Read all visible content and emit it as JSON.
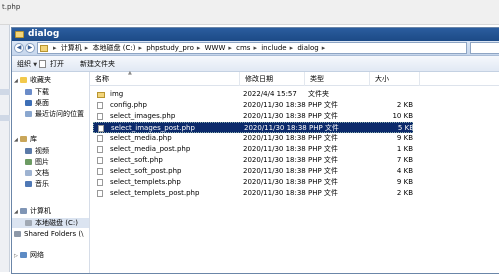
{
  "background": {
    "partial_title": "t.php"
  },
  "window": {
    "title": "dialog"
  },
  "address": {
    "crumbs": [
      "计算机",
      "本地磁盘 (C:)",
      "phpstudy_pro",
      "WWW",
      "cms",
      "include",
      "dialog"
    ]
  },
  "toolbar": {
    "organize": "组织",
    "open": "打开",
    "new_folder": "新建文件夹"
  },
  "nav": {
    "favorites": "收藏夹",
    "downloads": "下载",
    "desktop": "桌面",
    "recent": "最近访问的位置",
    "libraries": "库",
    "videos": "视频",
    "pictures": "图片",
    "documents": "文档",
    "music": "音乐",
    "computer": "计算机",
    "local_disk": "本地磁盘 (C:)",
    "shared": "Shared Folders (\\",
    "network": "网络"
  },
  "columns": {
    "name": "名称",
    "modified": "修改日期",
    "type": "类型",
    "size": "大小"
  },
  "files": [
    {
      "name": "img",
      "modified": "2022/4/4 15:57",
      "type": "文件夹",
      "size": "",
      "kind": "folder"
    },
    {
      "name": "config.php",
      "modified": "2020/11/30 18:38",
      "type": "PHP 文件",
      "size": "2 KB",
      "kind": "file"
    },
    {
      "name": "select_images.php",
      "modified": "2020/11/30 18:38",
      "type": "PHP 文件",
      "size": "10 KB",
      "kind": "file"
    },
    {
      "name": "select_images_post.php",
      "modified": "2020/11/30 18:38",
      "type": "PHP 文件",
      "size": "5 KB",
      "kind": "file"
    },
    {
      "name": "select_media.php",
      "modified": "2020/11/30 18:38",
      "type": "PHP 文件",
      "size": "9 KB",
      "kind": "file"
    },
    {
      "name": "select_media_post.php",
      "modified": "2020/11/30 18:38",
      "type": "PHP 文件",
      "size": "1 KB",
      "kind": "file"
    },
    {
      "name": "select_soft.php",
      "modified": "2020/11/30 18:38",
      "type": "PHP 文件",
      "size": "7 KB",
      "kind": "file"
    },
    {
      "name": "select_soft_post.php",
      "modified": "2020/11/30 18:38",
      "type": "PHP 文件",
      "size": "4 KB",
      "kind": "file"
    },
    {
      "name": "select_templets.php",
      "modified": "2020/11/30 18:38",
      "type": "PHP 文件",
      "size": "9 KB",
      "kind": "file"
    },
    {
      "name": "select_templets_post.php",
      "modified": "2020/11/30 18:38",
      "type": "PHP 文件",
      "size": "2 KB",
      "kind": "file"
    }
  ],
  "colors": {
    "selection": "#0c2a6b",
    "titlebar": "#1c4a86",
    "folder": "#f3d57a"
  }
}
